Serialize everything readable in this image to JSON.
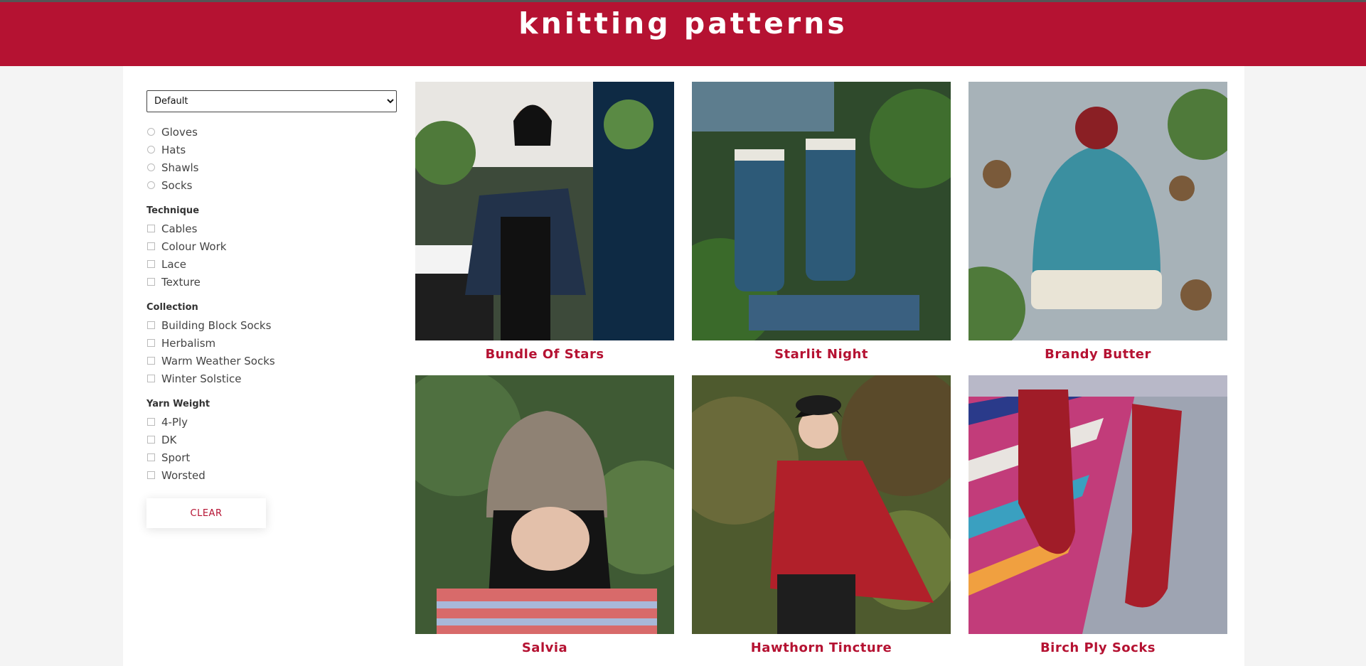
{
  "header": {
    "title": "knitting patterns"
  },
  "sort": {
    "selected": "Default"
  },
  "filters": {
    "categories": [
      "Gloves",
      "Hats",
      "Shawls",
      "Socks"
    ],
    "technique": {
      "title": "Technique",
      "items": [
        "Cables",
        "Colour Work",
        "Lace",
        "Texture"
      ]
    },
    "collection": {
      "title": "Collection",
      "items": [
        "Building Block Socks",
        "Herbalism",
        "Warm Weather Socks",
        "Winter Solstice"
      ]
    },
    "yarn_weight": {
      "title": "Yarn Weight",
      "items": [
        "4-Ply",
        "DK",
        "Sport",
        "Worsted"
      ]
    },
    "clear_label": "CLEAR"
  },
  "products": [
    {
      "title": "Bundle Of Stars",
      "image": "woman-in-shawl-by-piano"
    },
    {
      "title": "Starlit Night",
      "image": "fingerless-mitts-on-leaves"
    },
    {
      "title": "Brandy Butter",
      "image": "teal-bobble-hat-with-pinecones"
    },
    {
      "title": "Salvia",
      "image": "woman-in-cabled-beanie"
    },
    {
      "title": "Hawthorn Tincture",
      "image": "woman-in-red-shawl-outdoors"
    },
    {
      "title": "Birch Ply Socks",
      "image": "red-socks-on-striped-rug"
    }
  ],
  "colors": {
    "brand": "#b51232",
    "panel": "#ffffff",
    "page": "#f4f4f4"
  }
}
